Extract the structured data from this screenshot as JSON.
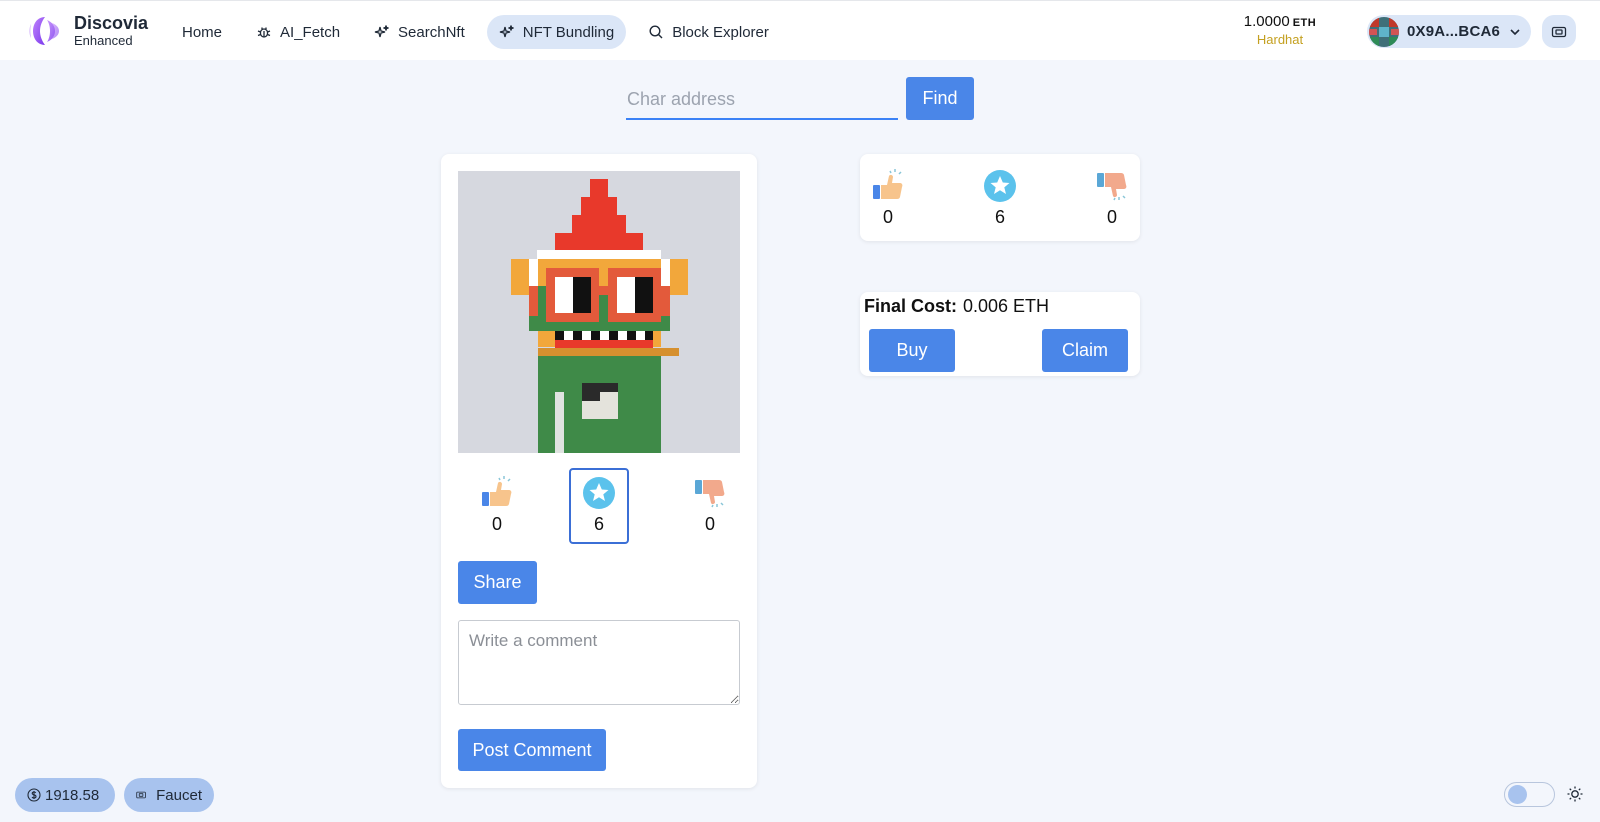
{
  "brand": {
    "name": "Discovia",
    "subtitle": "Enhanced"
  },
  "nav": [
    {
      "label": "Home",
      "icon": "none",
      "active": false
    },
    {
      "label": "AI_Fetch",
      "icon": "bug-icon",
      "active": false
    },
    {
      "label": "SearchNft",
      "icon": "sparkles-icon",
      "active": false
    },
    {
      "label": "NFT Bundling",
      "icon": "sparkles-icon",
      "active": true
    },
    {
      "label": "Block Explorer",
      "icon": "search-icon",
      "active": false
    }
  ],
  "wallet": {
    "balance": "1.0000",
    "unit": "ETH",
    "network": "Hardhat",
    "address": "0X9A...BCA6"
  },
  "search": {
    "placeholder": "Char address",
    "button_label": "Find"
  },
  "card": {
    "reactions": [
      {
        "icon": "thumbs-up-icon",
        "count": "0",
        "selected": false
      },
      {
        "icon": "star-icon",
        "count": "6",
        "selected": true
      },
      {
        "icon": "thumbs-down-icon",
        "count": "0",
        "selected": false
      }
    ],
    "share_label": "Share",
    "comment_placeholder": "Write a comment",
    "post_label": "Post Comment"
  },
  "stats": [
    {
      "icon": "thumbs-up-icon",
      "count": "0"
    },
    {
      "icon": "star-icon",
      "count": "6"
    },
    {
      "icon": "thumbs-down-icon",
      "count": "0"
    }
  ],
  "cost": {
    "label": "Final Cost:",
    "value": "0.006 ETH",
    "buy_label": "Buy",
    "claim_label": "Claim"
  },
  "footer": {
    "price": "1918.58",
    "faucet_label": "Faucet"
  },
  "colors": {
    "accent": "#4a86e8",
    "background": "#f3f6fc",
    "pill": "#a8c3ee",
    "network": "#c4a020"
  }
}
